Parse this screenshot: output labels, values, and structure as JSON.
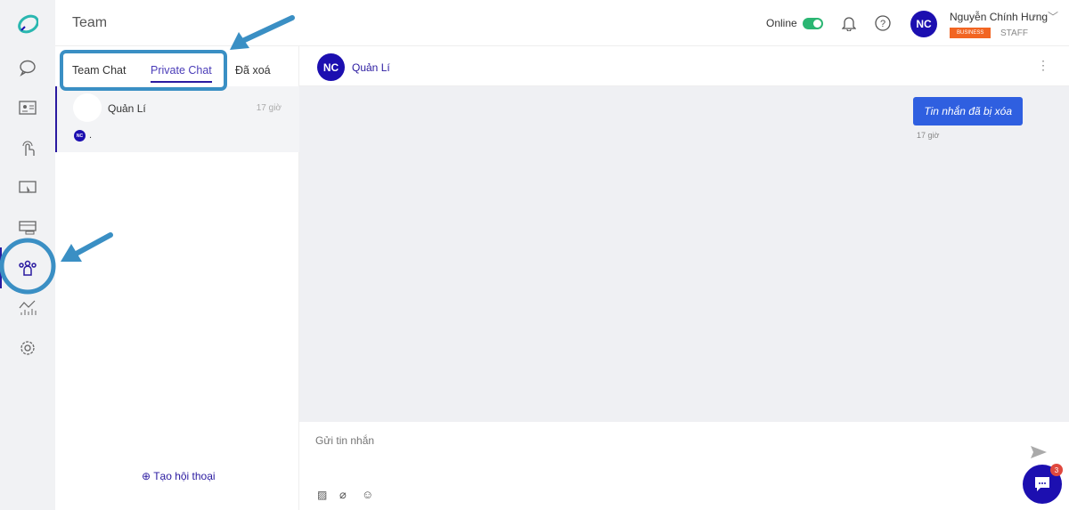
{
  "header": {
    "title": "Team",
    "status_label": "Online",
    "user_initials": "NC",
    "user_name": "Nguyễn Chính Hưng",
    "plan_badge": "BUSINESS",
    "role": "STAFF"
  },
  "tabs": [
    {
      "label": "Team Chat"
    },
    {
      "label": "Private Chat",
      "active": true
    },
    {
      "label": "Đã xoá"
    }
  ],
  "conversations": [
    {
      "name": "Quản Lí",
      "time": "17 giờ",
      "last_sender_initials": "NC",
      "last_message": "."
    }
  ],
  "new_conversation_label": "Tạo hội thoại",
  "chat": {
    "contact_initials": "NC",
    "contact_name": "Quản Lí",
    "messages": [
      {
        "text": "Tin nhắn đã bị xóa",
        "time": "17 giờ"
      }
    ],
    "input_placeholder": "Gửi tin nhắn"
  },
  "support_badge_count": "3",
  "colors": {
    "accent": "#1c0fb0",
    "bubble": "#2f5fe0",
    "toggle": "#2bb673",
    "badge": "#f26522",
    "annotation": "#3a8fc4"
  }
}
